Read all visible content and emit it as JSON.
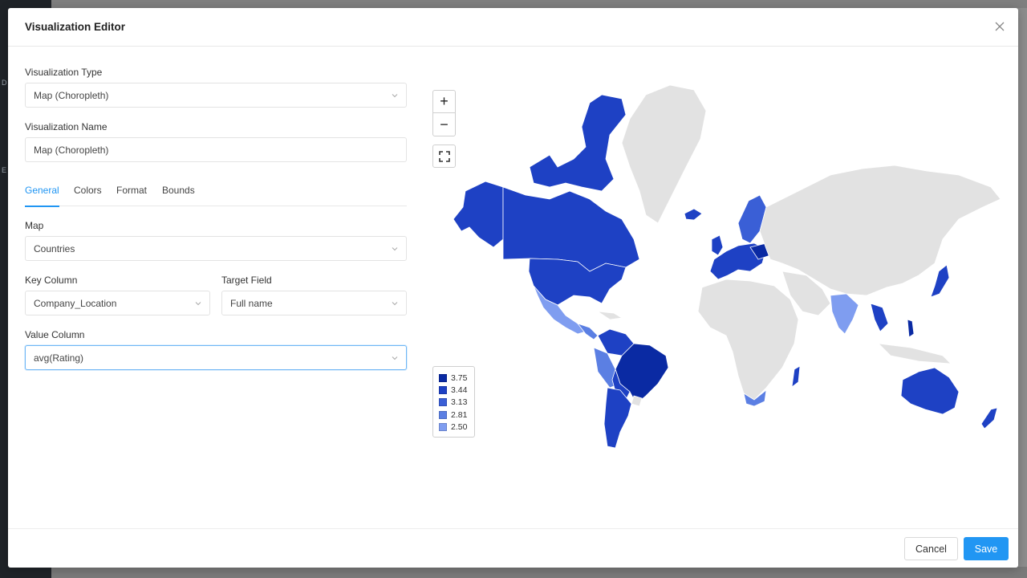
{
  "modal": {
    "title": "Visualization Editor"
  },
  "form": {
    "viz_type": {
      "label": "Visualization Type",
      "value": "Map (Choropleth)"
    },
    "viz_name": {
      "label": "Visualization Name",
      "value": "Map (Choropleth)"
    },
    "tabs": [
      {
        "label": "General",
        "active": true
      },
      {
        "label": "Colors",
        "active": false
      },
      {
        "label": "Format",
        "active": false
      },
      {
        "label": "Bounds",
        "active": false
      }
    ],
    "map": {
      "label": "Map",
      "value": "Countries"
    },
    "key_column": {
      "label": "Key Column",
      "value": "Company_Location"
    },
    "target_field": {
      "label": "Target Field",
      "value": "Full name"
    },
    "value_column": {
      "label": "Value Column",
      "value": "avg(Rating)"
    }
  },
  "map": {
    "zoom_in_label": "+",
    "zoom_out_label": "−",
    "legend": [
      {
        "label": "3.75",
        "color": "#0a2aa3"
      },
      {
        "label": "3.44",
        "color": "#1e41c4"
      },
      {
        "label": "3.13",
        "color": "#3a5fd6"
      },
      {
        "label": "2.81",
        "color": "#5b7fe3"
      },
      {
        "label": "2.50",
        "color": "#7f9df0"
      }
    ],
    "no_data_color": "#e2e2e2"
  },
  "footer": {
    "cancel_label": "Cancel",
    "save_label": "Save"
  },
  "colors": {
    "accent": "#2196f3"
  }
}
